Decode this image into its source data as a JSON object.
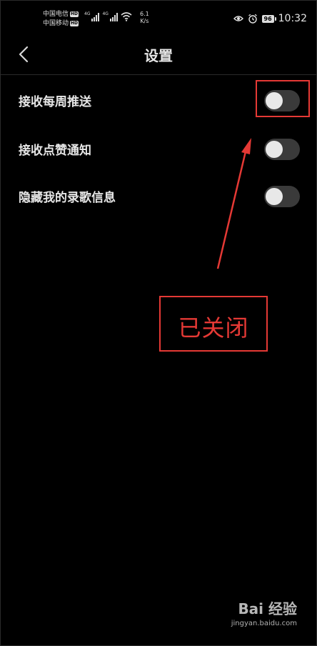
{
  "status_bar": {
    "carrier_1": "中国电信",
    "carrier_2": "中国移动",
    "hd_badge": "HD",
    "network_1": "4G",
    "network_2": "4G",
    "speed_value": "6.1",
    "speed_unit": "K/s",
    "battery": "96",
    "time": "10:32"
  },
  "header": {
    "title": "设置"
  },
  "settings": [
    {
      "label": "接收每周推送",
      "enabled": false
    },
    {
      "label": "接收点赞通知",
      "enabled": false
    },
    {
      "label": "隐藏我的录歌信息",
      "enabled": false
    }
  ],
  "annotation": {
    "text": "已关闭",
    "color": "#e53935"
  },
  "watermark": {
    "brand": "Bai 经验",
    "url": "jingyan.baidu.com"
  },
  "icons": {
    "back": "chevron-left-icon",
    "eye": "eye-icon",
    "alarm": "alarm-icon",
    "wifi": "wifi-icon"
  }
}
